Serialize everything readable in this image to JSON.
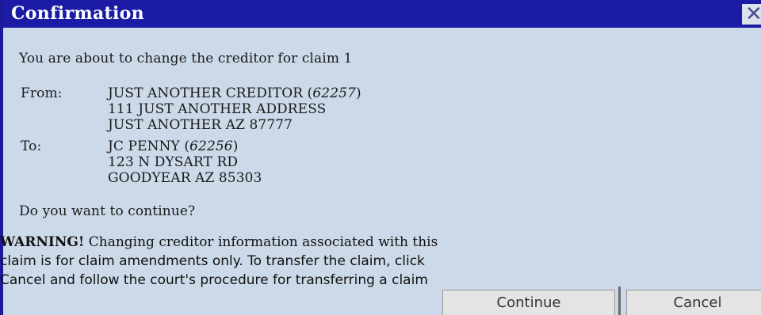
{
  "dialog": {
    "title": "Confirmation",
    "close_glyph": "✕",
    "intro": "You are about to change the creditor for claim 1",
    "from": {
      "label": "From:",
      "name": "JUST ANOTHER CREDITOR",
      "id": "62257",
      "line1": "111 JUST ANOTHER ADDRESS",
      "line2": "JUST ANOTHER AZ 87777"
    },
    "to": {
      "label": "To:",
      "name": "JC PENNY",
      "id": "62256",
      "line1": "123 N DYSART RD",
      "line2": "GOODYEAR AZ 85303"
    },
    "question": "Do you want to continue?",
    "warning": {
      "bold": "WARNING!",
      "line1": " Changing creditor information associated with this",
      "line2": "claim is for claim amendments only. To transfer the claim, click",
      "line3": "Cancel and follow the court's procedure for transferring a claim"
    },
    "buttons": {
      "continue": "Continue",
      "cancel": "Cancel"
    }
  },
  "colors": {
    "titlebar": "#1b1ba6",
    "background": "#ccd9e8"
  }
}
